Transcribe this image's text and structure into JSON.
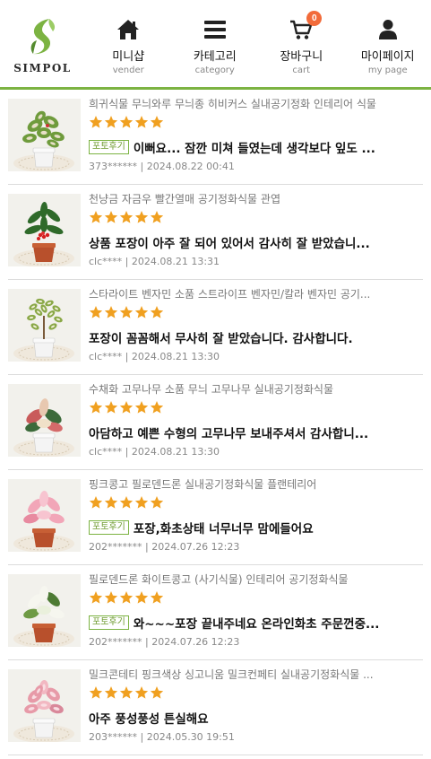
{
  "header": {
    "logo_text": "SIMPOL",
    "nav": [
      {
        "label": "미니샵",
        "sub": "vender",
        "icon": "home-icon"
      },
      {
        "label": "카테고리",
        "sub": "category",
        "icon": "menu-icon"
      },
      {
        "label": "장바구니",
        "sub": "cart",
        "icon": "cart-icon",
        "badge": "0"
      },
      {
        "label": "마이페이지",
        "sub": "my page",
        "icon": "user-icon"
      }
    ]
  },
  "colors": {
    "accent": "#7cb342",
    "star": "#f0a020",
    "badge": "#f26b3a"
  },
  "reviews": [
    {
      "product": "희귀식물 무늬와루 무늬종 히비커스 실내공기정화 인테리어 식물",
      "rating": 5,
      "photo_tag": "포토후기",
      "text": "이뻐요... 잠깐 미쳐 들였는데 생각보다 잎도 ...",
      "user": "373******",
      "date": "2024.08.22 00:41",
      "plant": "hibiscus"
    },
    {
      "product": "천냥금 자금우 빨간열매 공기정화식물 관엽",
      "rating": 5,
      "photo_tag": "",
      "text": "상품 포장이 아주 잘 되어 있어서 감사히 잘 받았습니...",
      "user": "clc****",
      "date": "2024.08.21 13:31",
      "plant": "berry"
    },
    {
      "product": "스타라이트 벤자민 소품 스트라이프 벤자민/칼라 벤자민 공기...",
      "rating": 5,
      "photo_tag": "",
      "text": "포장이 꼼꼼해서 무사히 잘 받았습니다. 감사합니다.",
      "user": "clc****",
      "date": "2024.08.21 13:30",
      "plant": "benjamin"
    },
    {
      "product": "수채화 고무나무 소품 무늬 고무나무 실내공기정화식물",
      "rating": 5,
      "photo_tag": "",
      "text": "아담하고 예쁜 수형의 고무나무 보내주셔서 감사합니...",
      "user": "clc****",
      "date": "2024.08.21 13:30",
      "plant": "rubber"
    },
    {
      "product": "핑크콩고 필로덴드론 실내공기정화식물 플랜테리어",
      "rating": 5,
      "photo_tag": "포토후기",
      "text": "포장,화초상태 너무너무 맘에들어요",
      "user": "202*******",
      "date": "2024.07.26 12:23",
      "plant": "pinkcongo"
    },
    {
      "product": "필로덴드론 화이트콩고 (사기식물) 인테리어 공기정화식물",
      "rating": 5,
      "photo_tag": "포토후기",
      "text": "와~~~포장 끝내주네요 온라인화초 주문껀중...",
      "user": "202*******",
      "date": "2024.07.26 12:23",
      "plant": "whitecongo"
    },
    {
      "product": "밀크콘테티 핑크색상 싱고니움 밀크컨페티 실내공기정화식물 ...",
      "rating": 5,
      "photo_tag": "",
      "text": "아주 풍성풍성 튼실해요",
      "user": "203******",
      "date": "2024.05.30 19:51",
      "plant": "syngonium"
    }
  ]
}
